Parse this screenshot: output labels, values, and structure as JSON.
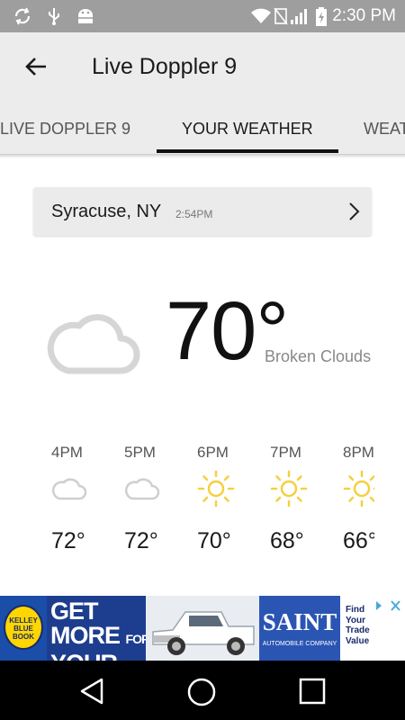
{
  "status_bar": {
    "time": "2:30 PM",
    "icons": [
      "sync-icon",
      "usb-icon",
      "android-debug-icon",
      "wifi-icon",
      "no-sim-icon",
      "signal-icon",
      "battery-charging-icon"
    ]
  },
  "app_bar": {
    "title": "Live Doppler 9",
    "back_icon": "arrow-back-icon"
  },
  "tabs": [
    {
      "label": "LIVE DOPPLER 9",
      "active": false
    },
    {
      "label": "YOUR WEATHER",
      "active": true
    },
    {
      "label": "WEATHER",
      "active": false
    }
  ],
  "location": {
    "name": "Syracuse, NY",
    "updated": "2:54PM",
    "chevron_icon": "chevron-right-icon"
  },
  "current": {
    "icon": "cloud-icon",
    "temperature": "70°",
    "condition": "Broken Clouds"
  },
  "hourly": [
    {
      "time": "4PM",
      "icon": "cloud-icon",
      "temp": "72°"
    },
    {
      "time": "5PM",
      "icon": "cloud-icon",
      "temp": "72°"
    },
    {
      "time": "6PM",
      "icon": "sun-icon",
      "temp": "70°"
    },
    {
      "time": "7PM",
      "icon": "sun-icon",
      "temp": "68°"
    },
    {
      "time": "8PM",
      "icon": "sun-icon",
      "temp": "66°"
    }
  ],
  "ad": {
    "kbb": "KELLEY BLUE BOOK",
    "line1": "GET MORE",
    "for": "FOR",
    "line2": "YOUR TRADE",
    "dealer": "SAINT",
    "dealer_sub": "AUTOMOBILE COMPANY",
    "cta": "Find Your Trade Value",
    "close_icon": "ad-close-icon"
  },
  "colors": {
    "status_bar": "#9e9e9e",
    "app_bar": "#ececec",
    "sun": "#f4d03f",
    "cloud": "#d6d6d6"
  },
  "nav": [
    "back-nav-icon",
    "home-nav-icon",
    "recents-nav-icon"
  ]
}
